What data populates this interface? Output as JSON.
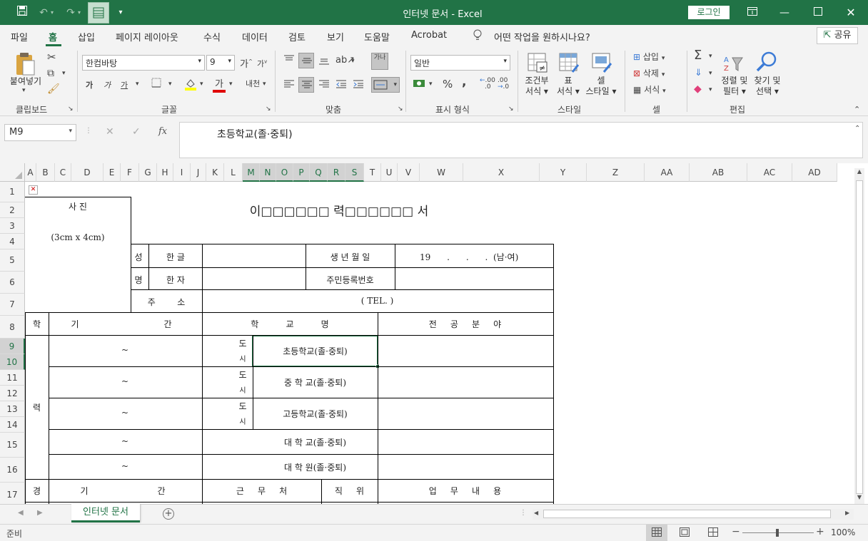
{
  "window": {
    "title": "인터넷 문서  -  Excel",
    "login_label": "로그인"
  },
  "tabs": [
    "파일",
    "홈",
    "삽입",
    "페이지 레이아웃",
    "수식",
    "데이터",
    "검토",
    "보기",
    "도움말",
    "Acrobat"
  ],
  "tell_me": "어떤 작업을 원하시나요?",
  "share_label": "공유",
  "ribbon": {
    "clipboard": {
      "paste": "붙여넣기",
      "group": "클립보드"
    },
    "font": {
      "name": "한컴바탕",
      "size": "9",
      "bold": "가",
      "italic": "가",
      "underline": "가",
      "font_color_letter": "가",
      "phonetic": "내천",
      "group": "글꼴"
    },
    "alignment": {
      "wrap": "가나",
      "group": "맞춤"
    },
    "number": {
      "format": "일반",
      "percent": "%",
      "comma": ",",
      "inc_decimal": ".00",
      "dec_decimal": ".00",
      "group": "표시 형식"
    },
    "styles": {
      "conditional": "조건부\n서식",
      "table": "표\n서식",
      "cell_style": "셀\n스타일",
      "group": "스타일"
    },
    "cells": {
      "insert": "삽입",
      "delete": "삭제",
      "format": "서식",
      "group": "셀"
    },
    "editing": {
      "sort": "정렬 및\n필터",
      "find": "찾기 및\n선택",
      "group": "편집"
    }
  },
  "formula_bar": {
    "name_box": "M9",
    "fx": "fx",
    "content": "초등학교(졸·중퇴)"
  },
  "columns": [
    "A",
    "B",
    "C",
    "D",
    "E",
    "F",
    "G",
    "H",
    "I",
    "J",
    "K",
    "L",
    "M",
    "N",
    "O",
    "P",
    "Q",
    "R",
    "S",
    "T",
    "U",
    "V",
    "W",
    "X",
    "Y",
    "Z",
    "AA",
    "AB",
    "AC",
    "AD"
  ],
  "rows": [
    "1",
    "2",
    "3",
    "4",
    "5",
    "6",
    "7",
    "8",
    "9",
    "10",
    "11",
    "12",
    "13",
    "14",
    "15",
    "16",
    "17"
  ],
  "form": {
    "title": "이□□□□□□ 력□□□□□□ 서",
    "photo_label": "사     진",
    "photo_size": "(3cm x 4cm)",
    "name_seong": "성",
    "name_myeong": "명",
    "hangul": "한 글",
    "hanja": "한 자",
    "birth_label": "생 년 월 일",
    "birth_value": "19      .      .      .  (남·여)",
    "resident_label": "주민등록번호",
    "address_label": "주        소",
    "tel": "( TEL. )",
    "edu_hak": "학",
    "edu_ryeok": "력",
    "period_gi": "기",
    "period_gan": "간",
    "school_header": "학          교          명",
    "major_header": "전     공     분     야",
    "do": "도",
    "si": "시",
    "tilde": "~",
    "schools": [
      "초등학교(졸·중퇴)",
      "중 학 교(졸·중퇴)",
      "고등학교(졸·중퇴)",
      "대 학 교(졸·중퇴)",
      "대 학 원(졸·중퇴)"
    ],
    "career_gyeong": "경",
    "work_place": "근     무     처",
    "position": "직     위",
    "duties": "업     무     내     용"
  },
  "sheet_tab": "인터넷 문서",
  "status": {
    "ready": "준비",
    "zoom": "100%"
  }
}
